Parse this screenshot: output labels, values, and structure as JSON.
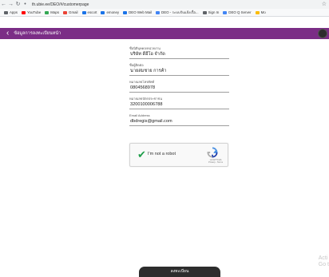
{
  "browser": {
    "url": "th.ubie.ee/DEO/#/customerpage",
    "bookmarks": [
      {
        "label": "Apps",
        "color": "#5f6368"
      },
      {
        "label": "YouTube",
        "color": "#ff0000"
      },
      {
        "label": "Maps",
        "color": "#34a853"
      },
      {
        "label": "Gmail",
        "color": "#ea4335"
      },
      {
        "label": "escort",
        "color": "#1a73e8"
      },
      {
        "label": "emoney",
        "color": "#1a73e8"
      },
      {
        "label": "DEO Web Mail",
        "color": "#1a73e8"
      },
      {
        "label": "DEO - ระบบรับแจ้งเรื่อ...",
        "color": "#4285f4"
      },
      {
        "label": "Sign In",
        "color": "#5f6368"
      },
      {
        "label": "DEO Q Server",
        "color": "#4285f4"
      },
      {
        "label": "Mo",
        "color": "#fbbc04"
      }
    ]
  },
  "appbar": {
    "title": "ข้อมูลการลงทะเบียนหน้า"
  },
  "form": {
    "fields": [
      {
        "label": "ชื่อนิติบุคคล/หน่วยงาน",
        "value": "บริษัท ดีอีโอ จำกัด"
      },
      {
        "label": "ชื่อผู้ติดต่อ",
        "value": "นายสมชาย การค้า"
      },
      {
        "label": "หมายเลขโทรศัพท์",
        "value": "0804568978"
      },
      {
        "label": "หมายเลขบัตรประชาชน",
        "value": "3200100006788"
      },
      {
        "label": "Email Address",
        "value": "dbdregis@gmail.com"
      }
    ]
  },
  "captcha": {
    "label": "I'm not a robot",
    "brand": "reCAPTCHA",
    "links": "Privacy - Terms"
  },
  "submit": {
    "label": "ลงทะเบียน"
  },
  "watermark": {
    "line1": "Acti",
    "line2": "Go t"
  }
}
